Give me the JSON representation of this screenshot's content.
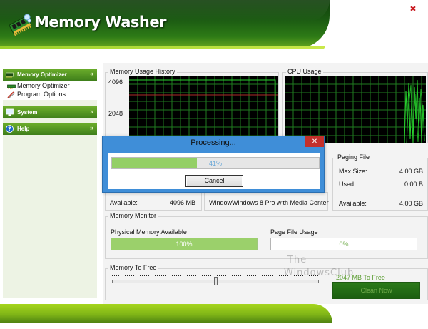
{
  "app": {
    "title": "Memory Washer",
    "close_label": "✖"
  },
  "sidebar": {
    "sections": [
      {
        "label": "Memory Optimizer",
        "chevron": "«",
        "items": [
          {
            "label": "Memory Optimizer",
            "icon": "memory-chip-icon"
          },
          {
            "label": "Program Options",
            "icon": "options-icon"
          }
        ]
      },
      {
        "label": "System",
        "chevron": "»"
      },
      {
        "label": "Help",
        "chevron": "»"
      }
    ]
  },
  "memory_history": {
    "title": "Memory Usage History",
    "y_labels": [
      "4096",
      "2048"
    ]
  },
  "cpu_usage": {
    "title": "CPU Usage"
  },
  "memory_info": {
    "available_label": "Available:",
    "available_value": "4096 MB"
  },
  "os_info": {
    "text": "WindowWindows 8 Pro with Media Center"
  },
  "paging_file": {
    "title": "Paging File",
    "rows": [
      {
        "label": "Max Size:",
        "value": "4.00 GB"
      },
      {
        "label": "Used:",
        "value": "0.00 B"
      },
      {
        "label": "Available:",
        "value": "4.00 GB"
      }
    ]
  },
  "memory_monitor": {
    "title": "Memory Monitor",
    "physical": {
      "label": "Physical Memory Available",
      "value_text": "100%",
      "fraction": 1.0
    },
    "page_file": {
      "label": "Page File Usage",
      "value_text": "0%",
      "fraction": 0.0
    }
  },
  "memory_to_free": {
    "title": "Memory To Free",
    "amount_text": "2047 MB To Free",
    "slider_fraction": 0.5,
    "clean_label": "Clean Now"
  },
  "watermark": {
    "line1": "The",
    "line2": "WindowsClub"
  },
  "dialog": {
    "title": "Processing...",
    "close_label": "✕",
    "progress_text": "41%",
    "progress_fraction": 0.41,
    "cancel_label": "Cancel"
  },
  "colors": {
    "brand_green": "#2d7a16",
    "accent_lime": "#a6d61d",
    "graph_line": "#22c52a",
    "graph_limit": "#c0392b",
    "dialog_blue": "#3f8ed8",
    "progress_fill": "#94cf66"
  }
}
